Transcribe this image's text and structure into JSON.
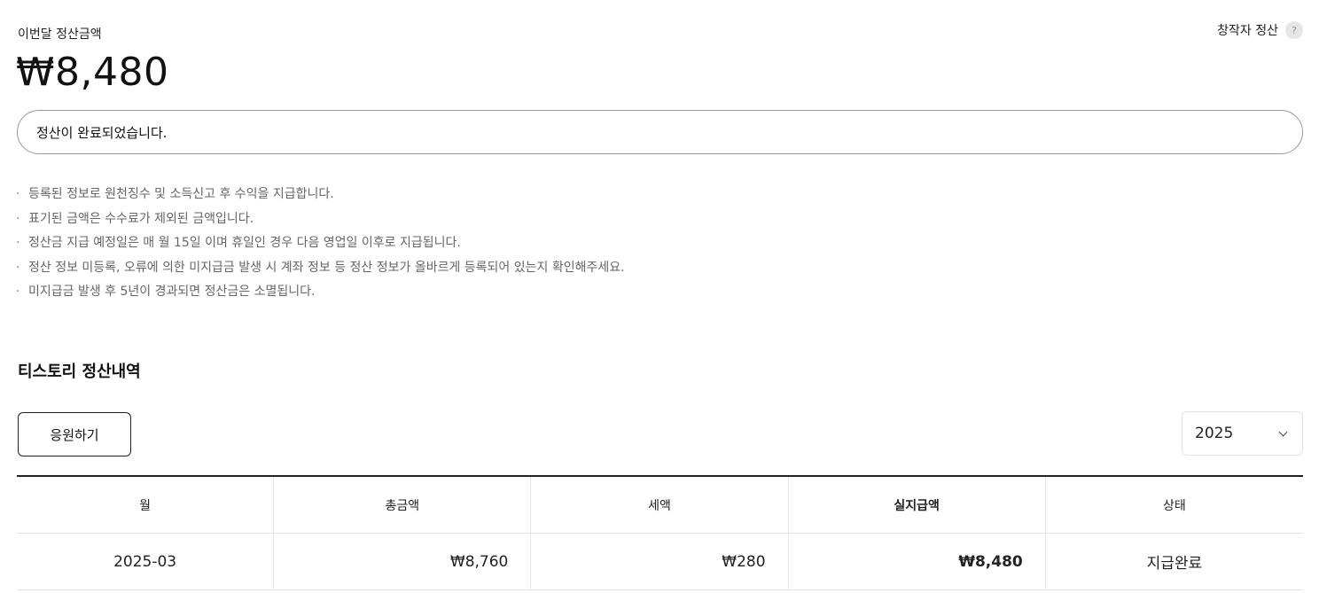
{
  "summary": {
    "label": "이번달 정산금액",
    "amount": "₩8,480",
    "settle_link": "창작자 정산",
    "help_icon": "?",
    "status_message": "정산이 완료되었습니다."
  },
  "notes": [
    "등록된 정보로 원천징수 및 소득신고 후 수익을 지급합니다.",
    "표기된 금액은 수수료가 제외된 금액입니다.",
    "정산금 지급 예정일은 매 월 15일 이며 휴일인 경우 다음 영업일 이후로 지급됩니다.",
    "정산 정보 미등록, 오류에 의한 미지급금 발생 시 계좌 정보 등 정산 정보가 올바르게 등록되어 있는지 확인해주세요.",
    "미지급금 발생 후 5년이 경과되면 정산금은 소멸됩니다."
  ],
  "bullet": "·",
  "history": {
    "title": "티스토리 정산내역",
    "support_button": "응원하기",
    "year_select": {
      "value": "2025"
    },
    "columns": [
      "월",
      "총금액",
      "세액",
      "실지급액",
      "상태"
    ],
    "rows": [
      {
        "month": "2025-03",
        "total": "₩8,760",
        "tax": "₩280",
        "paid": "₩8,480",
        "status": "지급완료"
      }
    ]
  }
}
